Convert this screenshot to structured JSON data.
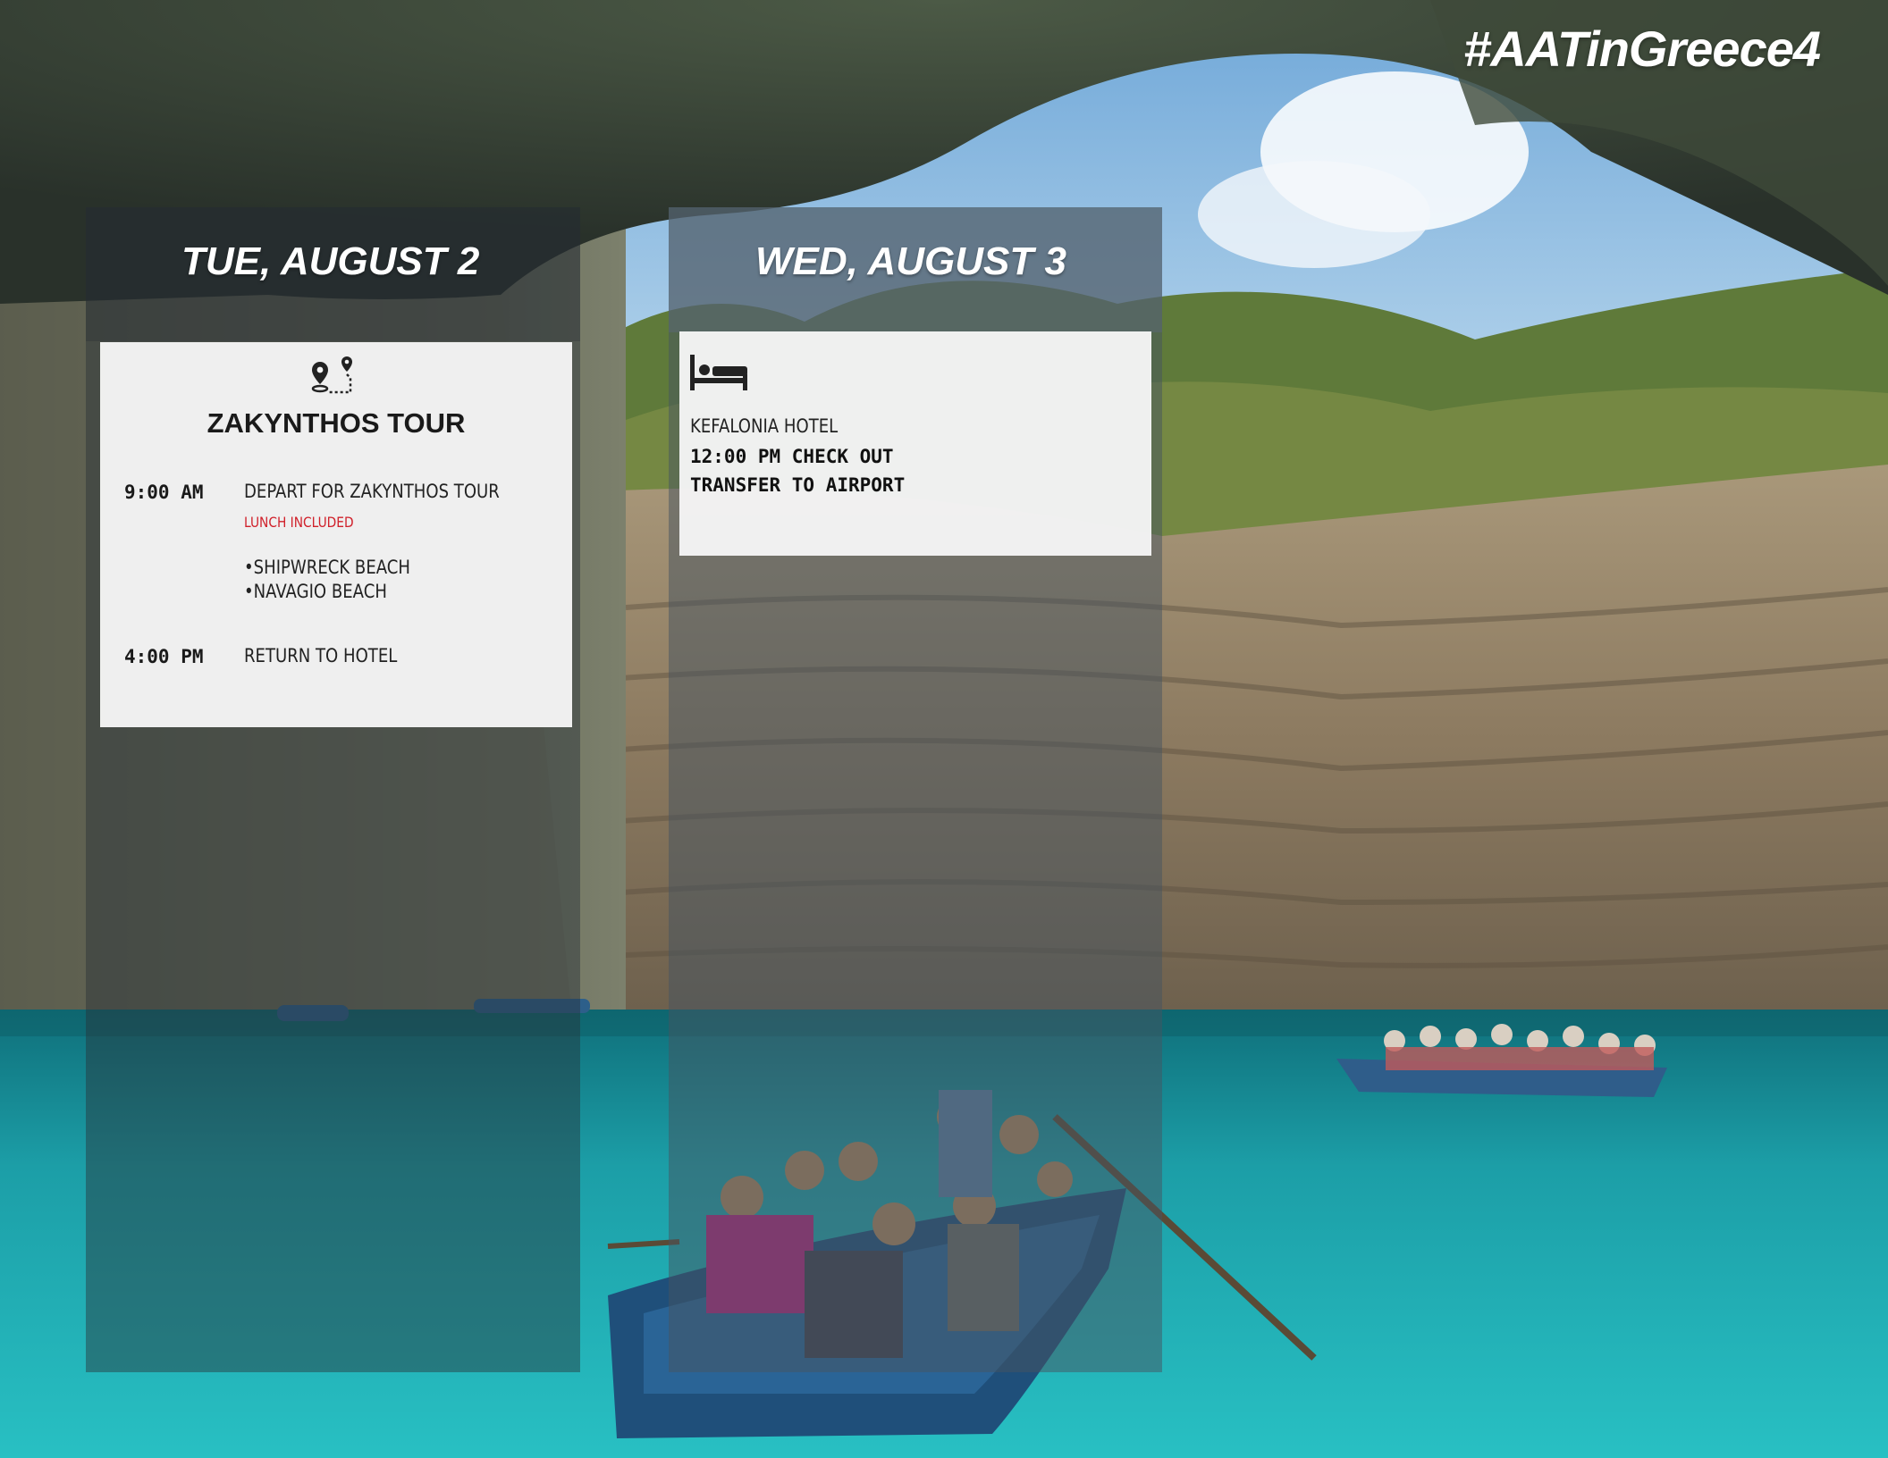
{
  "hashtag": "#AATinGreece4",
  "days": [
    {
      "title": "TUE, AUGUST 2",
      "card": {
        "icon": "route-map-icon",
        "heading": "ZAKYNTHOS TOUR",
        "items": [
          {
            "time": "9:00 AM",
            "text": "DEPART FOR ZAKYNTHOS TOUR",
            "note": "LUNCH INCLUDED"
          },
          {
            "bullets": [
              "•SHIPWRECK BEACH",
              "•NAVAGIO BEACH"
            ]
          },
          {
            "time": "4:00 PM",
            "text": "RETURN TO HOTEL"
          }
        ]
      }
    },
    {
      "title": "WED, AUGUST 3",
      "card": {
        "icon": "bed-icon",
        "place": "KEFALONIA HOTEL",
        "lines": [
          "12:00 PM CHECK OUT",
          "TRANSFER TO AIRPORT"
        ]
      }
    }
  ],
  "colors": {
    "note_red": "#d0202a",
    "water": "#1fa9b0",
    "sky": "#a9d1ec"
  }
}
